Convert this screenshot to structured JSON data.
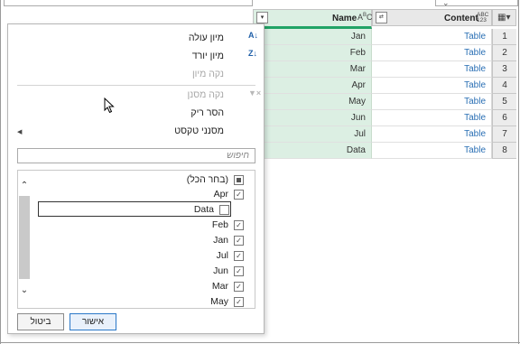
{
  "grid": {
    "columns": [
      {
        "name": "Name",
        "type_icon": "ABC"
      },
      {
        "name": "Content",
        "type_icon": "ABC\n123"
      }
    ],
    "rows": [
      {
        "num": "1",
        "name": "Jan",
        "content": "Table"
      },
      {
        "num": "2",
        "name": "Feb",
        "content": "Table"
      },
      {
        "num": "3",
        "name": "Mar",
        "content": "Table"
      },
      {
        "num": "4",
        "name": "Apr",
        "content": "Table"
      },
      {
        "num": "5",
        "name": "May",
        "content": "Table"
      },
      {
        "num": "6",
        "name": "Jun",
        "content": "Table"
      },
      {
        "num": "7",
        "name": "Jul",
        "content": "Table"
      },
      {
        "num": "8",
        "name": "Data",
        "content": "Table"
      }
    ]
  },
  "filter_menu": {
    "sort_asc": "מיון עולה",
    "sort_desc": "מיון יורד",
    "clear_sort": "נקה מיון",
    "clear_filter": "נקה מסנן",
    "remove_empty": "הסר ריק",
    "text_filters": "מסנני טקסט",
    "search_placeholder": "חיפוש",
    "select_all": "(בחר הכל)",
    "items": [
      {
        "label": "Apr",
        "checked": true
      },
      {
        "label": "Data",
        "checked": false
      },
      {
        "label": "Feb",
        "checked": true
      },
      {
        "label": "Jan",
        "checked": true
      },
      {
        "label": "Jul",
        "checked": true
      },
      {
        "label": "Jun",
        "checked": true
      },
      {
        "label": "Mar",
        "checked": true
      },
      {
        "label": "May",
        "checked": true
      }
    ],
    "ok_label": "אישור",
    "cancel_label": "ביטול"
  }
}
